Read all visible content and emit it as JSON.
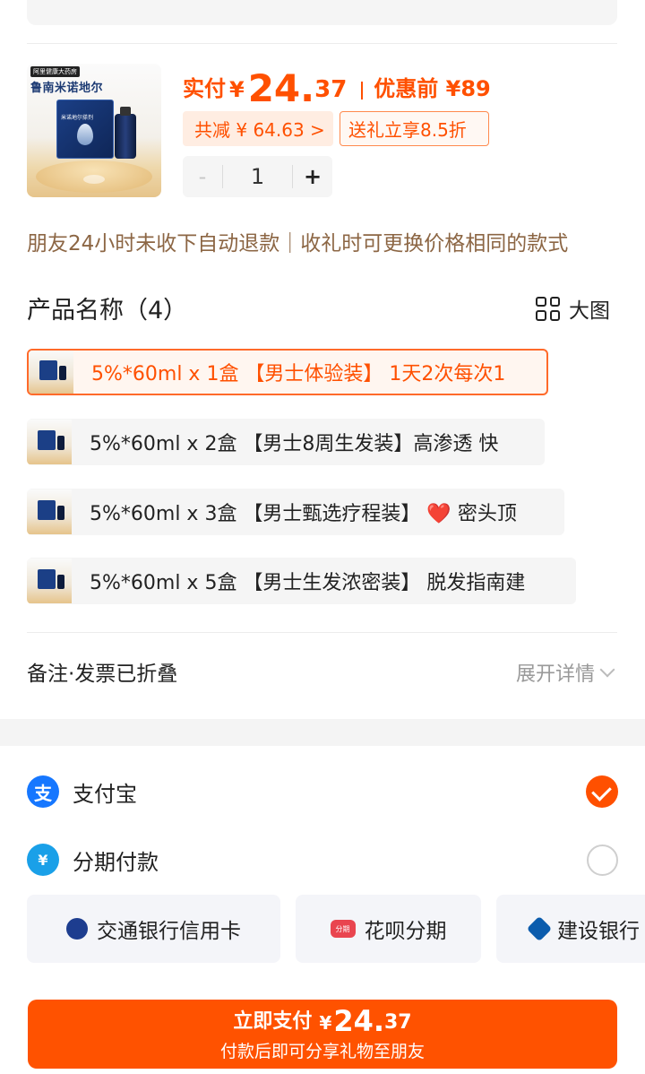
{
  "product": {
    "image_store_tag": "阿里健康大药房",
    "image_brand": "鲁南米诺地尔",
    "image_box_label": "米诺地尔搽剂",
    "price_label": "实付",
    "price_currency": "¥",
    "price_int": "24.",
    "price_dec": "37",
    "original_price": "优惠前 ¥89",
    "discount_tag": "共减 ¥ 64.63 >",
    "gift_tag": "送礼立享8.5折",
    "stepper": {
      "minus": "-",
      "quantity": "1",
      "plus": "+"
    }
  },
  "notice": "朋友24小时未收下自动退款｜收礼时可更换价格相同的款式",
  "options_section": {
    "title": "产品名称（4）",
    "big_view_label": "大图",
    "items": [
      {
        "label": "5%*60ml x 1盒 【男士体验装】 1天2次每次1"
      },
      {
        "label": "5%*60ml x 2盒 【男士8周生发装】高渗透 快"
      },
      {
        "label": "5%*60ml x 3盒 【男士甄选疗程装】 ❤️ 密头顶"
      },
      {
        "label": "5%*60ml x 5盒 【男士生发浓密装】 脱发指南建"
      }
    ],
    "selected_index": 0
  },
  "remark": {
    "label": "备注·发票已折叠",
    "expand_label": "展开详情"
  },
  "payment": {
    "methods": [
      {
        "label": "支付宝",
        "icon": "alipay-icon",
        "icon_glyph": "支",
        "selected": true
      },
      {
        "label": "分期付款",
        "icon": "installment-icon",
        "icon_glyph": "¥",
        "selected": false
      }
    ],
    "banks": [
      {
        "label": "交通银行信用卡",
        "icon": "bocom-icon"
      },
      {
        "label": "花呗分期",
        "icon": "huabei-icon",
        "icon_text": "分期"
      },
      {
        "label": "建设银行",
        "icon": "ccb-icon"
      }
    ]
  },
  "pay_button": {
    "label": "立即支付",
    "currency": "¥",
    "amount_int": "24.",
    "amount_dec": "37",
    "sub_label": "付款后即可分享礼物至朋友"
  },
  "colors": {
    "accent": "#ff5000",
    "notice": "#8c6644",
    "alipay": "#1677ff"
  }
}
